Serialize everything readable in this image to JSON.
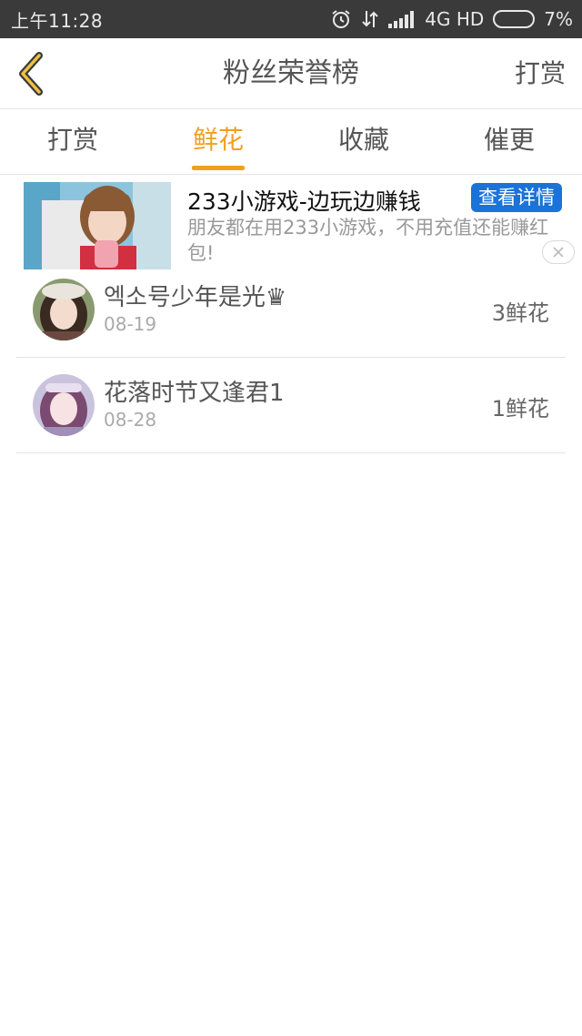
{
  "status_bar": {
    "time": "上午11:28",
    "network": "4G HD",
    "battery": "7%",
    "battery_level": 0.07
  },
  "header": {
    "title": "粉丝荣誉榜",
    "action": "打赏"
  },
  "tabs": [
    {
      "label": "打赏",
      "active": false
    },
    {
      "label": "鲜花",
      "active": true
    },
    {
      "label": "收藏",
      "active": false
    },
    {
      "label": "催更",
      "active": false
    }
  ],
  "ad": {
    "title": "233小游戏-边玩边赚钱",
    "button": "查看详情",
    "description": "朋友都在用233小游戏，不用充值还能赚红包!"
  },
  "list": [
    {
      "name": "엑소号少年是光♛",
      "date": "08-19",
      "count": "3鲜花"
    },
    {
      "name": "花落时节又逢君1",
      "date": "08-28",
      "count": "1鲜花"
    }
  ],
  "colors": {
    "accent": "#f0a020",
    "ad_button": "#1a73d9",
    "status_bar": "#3a3a3a"
  }
}
